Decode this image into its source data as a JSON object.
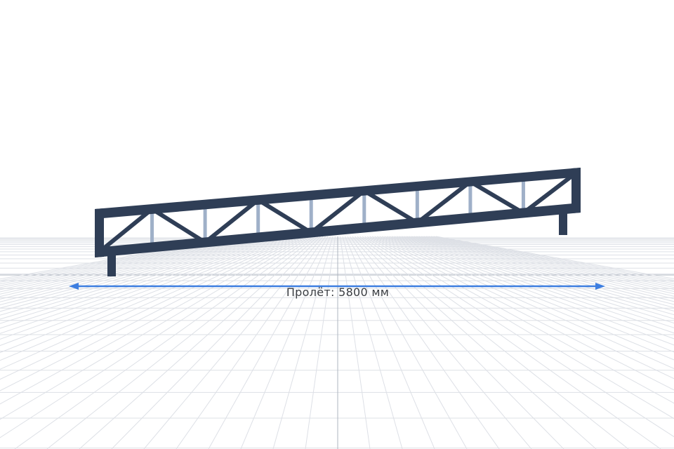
{
  "dimension": {
    "label": "Пролёт: 5800 мм"
  },
  "colors": {
    "background": "#ffffff",
    "grid_line": "#dde0e6",
    "grid_axis": "#aeb4bf",
    "truss_chord": "#2f3e56",
    "truss_web": "#2f3e56",
    "truss_post": "#9fb0c8",
    "dimension_line": "#3d7ee0"
  }
}
